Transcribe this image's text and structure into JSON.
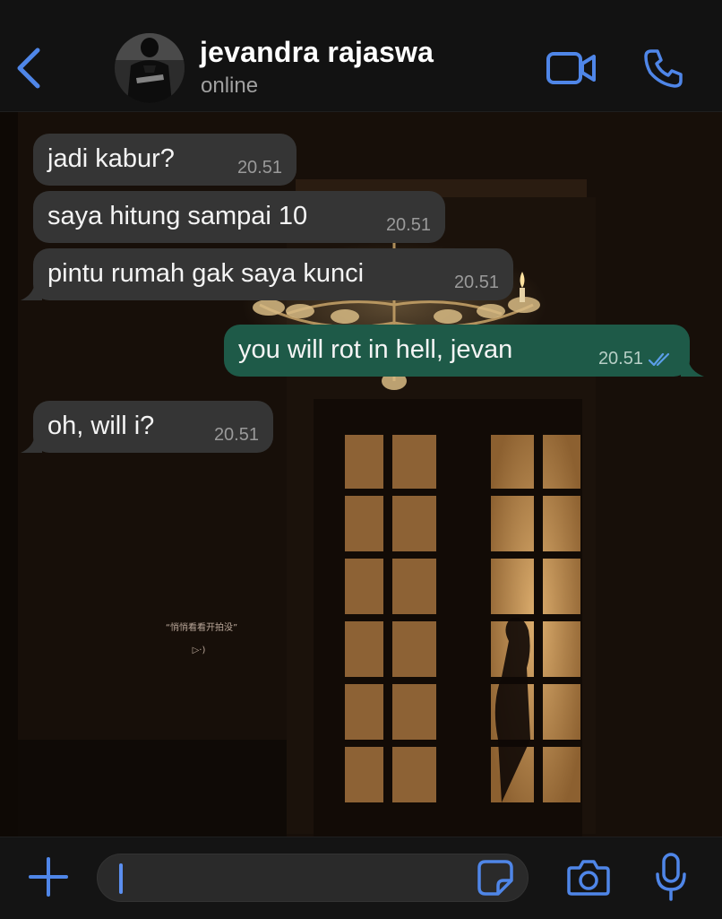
{
  "header": {
    "contact_name": "jevandra rajaswa",
    "status": "online",
    "back_icon": "chevron-left-icon",
    "video_icon": "video-camera-icon",
    "call_icon": "phone-icon"
  },
  "wallpaper": {
    "caption_line1": "“悄悄看看开拍没”",
    "caption_line2": "▷·)"
  },
  "messages": [
    {
      "direction": "incoming",
      "text": "jadi kabur?",
      "time": "20.51"
    },
    {
      "direction": "incoming",
      "text": "saya hitung sampai 10",
      "time": "20.51"
    },
    {
      "direction": "incoming",
      "text": "pintu rumah gak saya kunci",
      "time": "20.51"
    },
    {
      "direction": "outgoing",
      "text": "you will rot in hell, jevan",
      "time": "20.51",
      "status": "read"
    },
    {
      "direction": "incoming",
      "text": "oh, will i?",
      "time": "20.51"
    }
  ],
  "input_bar": {
    "placeholder": "",
    "value": "",
    "icons": [
      "plus-icon",
      "sticker-icon",
      "camera-icon",
      "microphone-icon"
    ]
  },
  "colors": {
    "accent": "#4f86e8",
    "incoming_bubble": "#353535",
    "outgoing_bubble": "#1e5a48",
    "header_bg": "#121212"
  }
}
